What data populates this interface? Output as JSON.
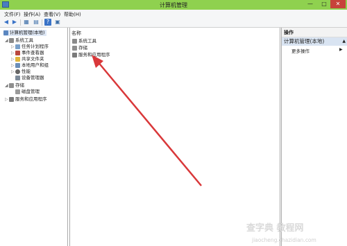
{
  "window": {
    "title": "计算机管理"
  },
  "titlebar": {
    "minimize": "—",
    "maximize": "□",
    "close": "✕"
  },
  "menu": [
    "文件(F)",
    "操作(A)",
    "查看(V)",
    "帮助(H)"
  ],
  "toolbar": {
    "back": "◀",
    "forward": "▶",
    "show_tree": "▦",
    "properties": "▤",
    "help": "?",
    "view": "▣"
  },
  "tree": {
    "root": "计算机管理(本地)",
    "system_tools": "系统工具",
    "task_scheduler": "任务计划程序",
    "event_viewer": "事件查看器",
    "shared_folders": "共享文件夹",
    "local_users": "本地用户和组",
    "performance": "性能",
    "device_manager": "设备管理器",
    "storage": "存储",
    "disk_management": "磁盘管理",
    "services_apps": "服务和应用程序",
    "expand": "▷",
    "collapse": "◢"
  },
  "list": {
    "column_name": "名称",
    "items": [
      "系统工具",
      "存储",
      "服务和应用程序"
    ]
  },
  "actions": {
    "header": "操作",
    "section": "计算机管理(本地)",
    "collapse": "▲",
    "more": "更多操作",
    "more_arrow": "▶"
  },
  "watermark": {
    "logo": "查字典 教程网",
    "url": "jiaocheng.chazidian.com"
  },
  "colors": {
    "titlebar": "#8fd14f",
    "selection": "#dfe8f6",
    "actions_section": "#d9e4f2",
    "arrow": "#d9383a"
  }
}
